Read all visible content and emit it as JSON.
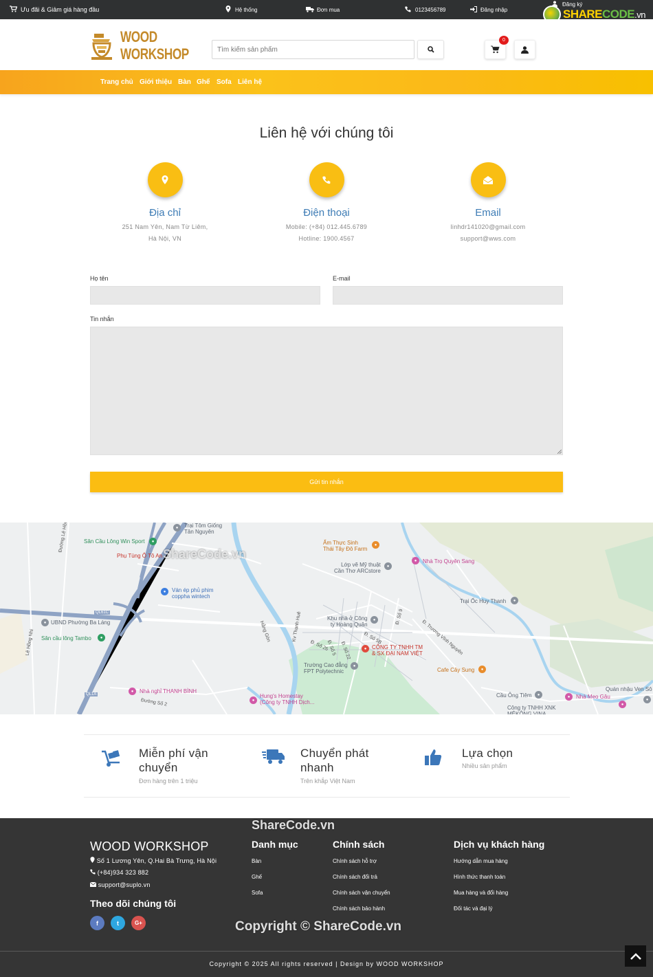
{
  "topbar": {
    "promo": "Ưu đãi & Giảm giá hàng đầu",
    "system": "Hệ thống",
    "orders": "Đơn mua",
    "phone": "0123456789",
    "login": "Đăng nhập",
    "register": "Đăng ký"
  },
  "sharecode_logo": {
    "part1": "SHARE",
    "part2": "CODE",
    "part3": ".vn"
  },
  "brand": {
    "line1": "WOOD",
    "line2": "WORKSHOP"
  },
  "search": {
    "placeholder": "Tìm kiếm sản phẩm"
  },
  "cart": {
    "count": "0"
  },
  "nav": [
    "Trang chủ",
    "Giới thiệu",
    "Bàn",
    "Ghế",
    "Sofa",
    "Liên hệ"
  ],
  "contact": {
    "title": "Liên hệ với chúng tôi",
    "address": {
      "heading": "Địa chỉ",
      "line1": "251 Nam Yên, Nam Từ Liêm,",
      "line2": "Hà Nội, VN"
    },
    "phone": {
      "heading": "Điện thoại",
      "line1": "Mobile: (+84) 012.445.6789",
      "line2": "Hotline: 1900.4567"
    },
    "email": {
      "heading": "Email",
      "line1": "linhdr141020@gmail.com",
      "line2": "support@wws.com"
    }
  },
  "form": {
    "name_label": "Họ tên",
    "email_label": "E-mail",
    "message_label": "Tin nhắn",
    "submit": "Gửi tin nhắn"
  },
  "map": {
    "labels": {
      "trai_tom": "Trại Tôm Giống\nTân Nguyên",
      "san_cau_long_win": "Sân Cầu Lông Win Sport",
      "phu_tung": "Phụ Tùng Ô Tô An",
      "van_ep": "Ván ép phủ phim\ncoppha wintech",
      "ubnd": "UBND Phường Ba Láng",
      "san_cau_long_tambo": "Sân cầu lông Tambo",
      "nha_nghi": "Nhà nghỉ THANH BÌNH",
      "am_thuc": "Ẩm Thực Sinh\nThái Tây Đô Farm",
      "lop_ve": "Lớp vẽ Mỹ thuật\nCần Thơ ARCstore",
      "nha_tro": "Nhà Trọ Quyên Sang",
      "trai_oc": "Trại Ốc Huy Thanh",
      "khu_nha_o": "Khu nhà ở Công\nty Hoàng Quân",
      "cong_ty_tm": "CÔNG TY TNHH TM\n& SX ĐẠI NAM VIỆT",
      "truong_cd": "Trường Cao đẳng\nFPT Polytechnic",
      "cafe": "Cafe Cây Sung",
      "hungs": "Hung's Homestay\n(Công ty TNHH Dịch...",
      "cau_ong_tiem": "Cầu Ông Tiêm",
      "nha_meo": "Nhà Meo Gâu",
      "quan_nhau": "Quán nhậu Ven Sô",
      "cong_ty_xnk": "Công ty TNHH XNK\nMÊKÔNG VINA"
    },
    "roads": {
      "le_hong_nhi_1": "Đường Lê Hồng Nhi",
      "le_hong_nhi_2": "Lê Hồng Nhi",
      "ql61c": "QL61C",
      "ql1a": "QL1A",
      "hang_gon": "Hằng Gòn",
      "kv_thanh_hue": "Kv Thạnh Huê",
      "truong_vinh_nguyen": "Đ. Trương Vĩnh Nguyên",
      "duong_so_2": "Đường Số 2",
      "so_26": "Đ. Số 26",
      "so_5": "Đ. Số 5",
      "so_22": "Đ. Số 22",
      "so_9": "Đ. Số 9",
      "so_5b": "Đ. Số 5B"
    },
    "watermark": "ShareCode.vn"
  },
  "features": [
    {
      "title": "Miễn phí vận chuyển",
      "subtitle": "Đơn hàng trên 1 triệu"
    },
    {
      "title": "Chuyển phát nhanh",
      "subtitle": "Trên khắp Việt Nam"
    },
    {
      "title": "Lựa chọn",
      "subtitle": "Nhiều sản phẩm"
    }
  ],
  "footer": {
    "brand": "WOOD WORKSHOP",
    "address": "Số 1 Lương Yên, Q.Hai Bà Trưng, Hà Nội",
    "phone": "(+84)934 323 882",
    "email": "support@suplo.vn",
    "follow": "Theo dõi chúng tôi",
    "social": [
      "f",
      "t",
      "G+"
    ],
    "columns": [
      {
        "title": "Danh mục",
        "items": [
          "Bàn",
          "Ghế",
          "Sofa"
        ]
      },
      {
        "title": "Chính sách",
        "items": [
          "Chính sách hỗ trợ",
          "Chính sách đổi trả",
          "Chính sách vận chuyển",
          "Chính sách bảo hành"
        ]
      },
      {
        "title": "Dịch vụ khách hàng",
        "items": [
          "Hướng dẫn mua hàng",
          "Hình thức thanh toán",
          "Mua hàng và đổi hàng",
          "Đối tác và đại lý"
        ]
      }
    ],
    "watermark_top": "ShareCode.vn",
    "watermark_copy": "Copyright © ShareCode.vn",
    "copyright": "Copyright © 2025 All rights reserved | Design by WOOD WORKSHOP"
  },
  "colors": {
    "accent": "#fbbd12",
    "nav_start": "#f7a41d",
    "heading_blue": "#3e7cb5",
    "footer_bg": "#353535",
    "topbar_bg": "#2f3132"
  }
}
